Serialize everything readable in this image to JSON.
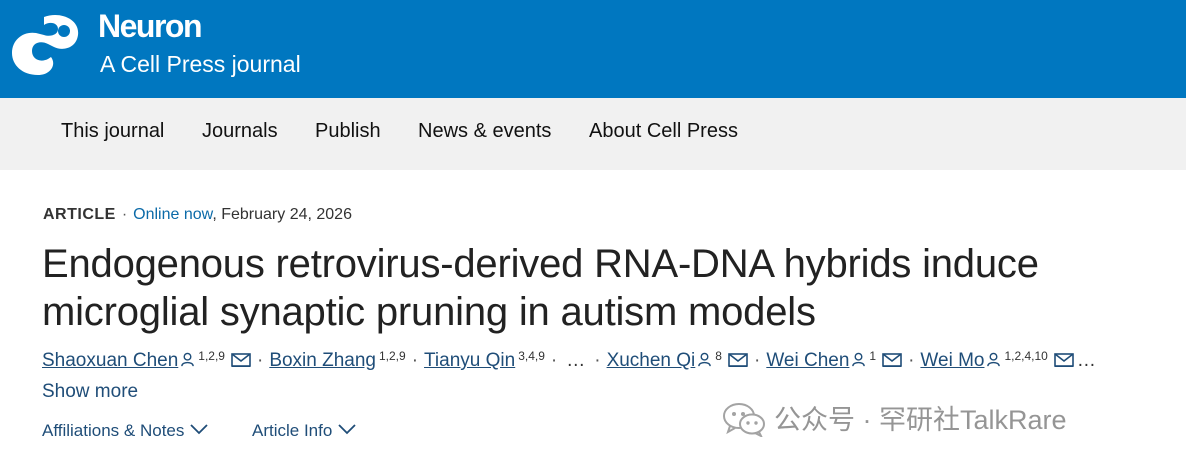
{
  "brand": {
    "name": "Neuron",
    "subtitle": "A Cell Press journal",
    "color": "#0077c0"
  },
  "nav": {
    "items": [
      {
        "label": "This journal"
      },
      {
        "label": "Journals"
      },
      {
        "label": "Publish"
      },
      {
        "label": "News & events"
      },
      {
        "label": "About Cell Press"
      }
    ]
  },
  "article": {
    "type": "ARTICLE",
    "online_label": "Online now",
    "date": ", February 24, 2026",
    "title": "Endogenous retrovirus-derived RNA-DNA hybrids induce microglial synaptic pruning in autism models",
    "authors": [
      {
        "name": "Shaoxuan Chen",
        "affil": "1,2,9",
        "profile_icon": true,
        "email_icon": true
      },
      {
        "name": "Boxin Zhang",
        "affil": "1,2,9",
        "profile_icon": false,
        "email_icon": false
      },
      {
        "name": "Tianyu Qin",
        "affil": "3,4,9",
        "profile_icon": false,
        "email_icon": false
      },
      {
        "name": "Xuchen Qi",
        "affil": "8",
        "profile_icon": true,
        "email_icon": true
      },
      {
        "name": "Wei Chen",
        "affil": "1",
        "profile_icon": true,
        "email_icon": true
      },
      {
        "name": "Wei Mo",
        "affil": "1,2,4,10",
        "profile_icon": true,
        "email_icon": true
      }
    ],
    "separator": "·",
    "ellipsis": "…",
    "show_more": "Show more"
  },
  "tabs": {
    "affiliations": "Affiliations & Notes",
    "article_info": "Article Info"
  },
  "watermark": {
    "text": "公众号 · 罕研社TalkRare"
  },
  "icons": {
    "logo": "cell-press-logo-icon",
    "profile": "person-icon",
    "email": "envelope-icon",
    "expand": "chevron-down-icon"
  }
}
